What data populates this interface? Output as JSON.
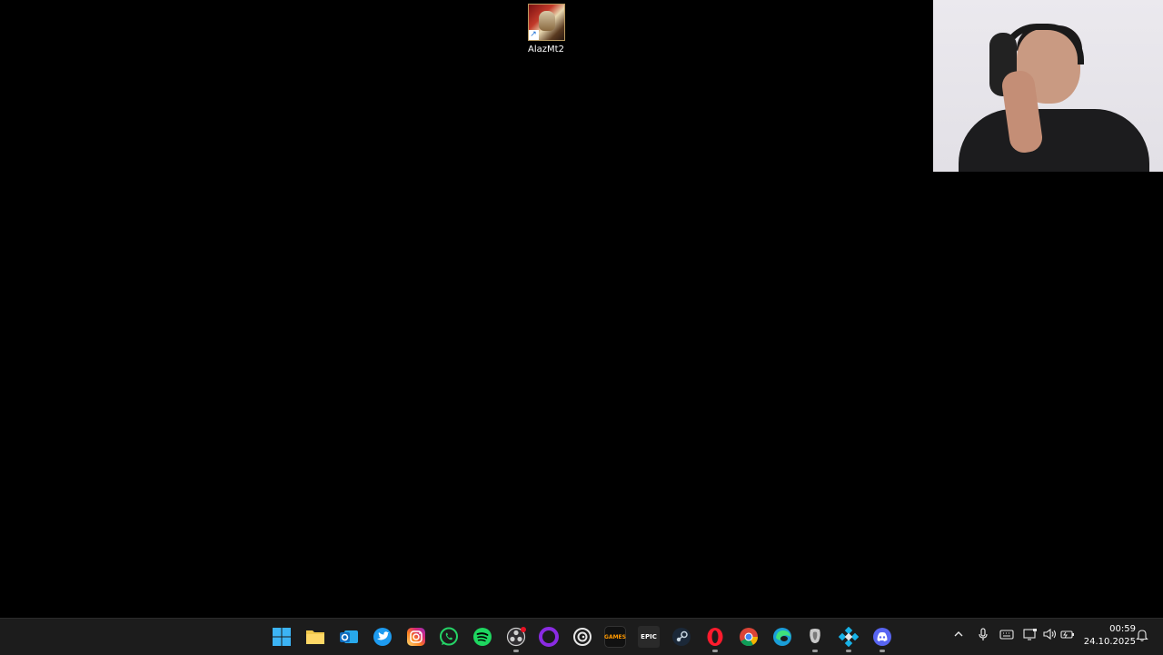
{
  "desktop": {
    "icons": [
      {
        "label": "AlazMt2",
        "icon": "alazmt2-game-shortcut-icon"
      }
    ],
    "background": "#000000"
  },
  "webcam": {
    "visible": true,
    "content": "webcam-feed"
  },
  "taskbar": {
    "apps": [
      {
        "name": "start",
        "icon": "windows-start-icon",
        "color": "#2aa7f5"
      },
      {
        "name": "file-explorer",
        "icon": "folder-icon",
        "color": "#f2c94c"
      },
      {
        "name": "outlook",
        "icon": "outlook-icon",
        "color": "#0f6cbd"
      },
      {
        "name": "twitter",
        "icon": "twitter-icon",
        "color": "#1d9bf0"
      },
      {
        "name": "instagram",
        "icon": "instagram-icon",
        "color": "#d6249f"
      },
      {
        "name": "whatsapp",
        "icon": "whatsapp-icon",
        "color": "#25d366"
      },
      {
        "name": "spotify",
        "icon": "spotify-icon",
        "color": "#1ed760"
      },
      {
        "name": "obs",
        "icon": "obs-icon",
        "color": "#302e31"
      },
      {
        "name": "app-purple-circle",
        "icon": "purple-circle-icon",
        "color": "#7b16ff"
      },
      {
        "name": "ubisoft-connect",
        "icon": "ubisoft-icon",
        "color": "#e6e6e6"
      },
      {
        "name": "amazon-games",
        "icon": "amazon-games-icon",
        "color": "#111111"
      },
      {
        "name": "epic-games",
        "icon": "epic-games-icon",
        "color": "#2a2a2a"
      },
      {
        "name": "steam",
        "icon": "steam-icon",
        "color": "#1b2838"
      },
      {
        "name": "opera",
        "icon": "opera-icon",
        "color": "#ff1b2d"
      },
      {
        "name": "chrome",
        "icon": "chrome-icon",
        "color": "#4285f4"
      },
      {
        "name": "edge",
        "icon": "edge-icon",
        "color": "#1a9ed8"
      },
      {
        "name": "game-app",
        "icon": "game-app-icon",
        "color": "#c9c9c9"
      },
      {
        "name": "kodi",
        "icon": "kodi-icon",
        "color": "#17b2e7"
      },
      {
        "name": "discord",
        "icon": "discord-icon",
        "color": "#5865f2"
      }
    ],
    "glyphs": {
      "epic": "EPIC",
      "amazon": "GAMES"
    },
    "tray": {
      "chevron": "^",
      "mic": "🎙",
      "keyboard": "⌨",
      "network": "🖥",
      "volume": "🔊",
      "battery": "🔋",
      "notification": "🔔"
    },
    "clock": {
      "time": "00:59",
      "date": "24.10.2025"
    }
  }
}
